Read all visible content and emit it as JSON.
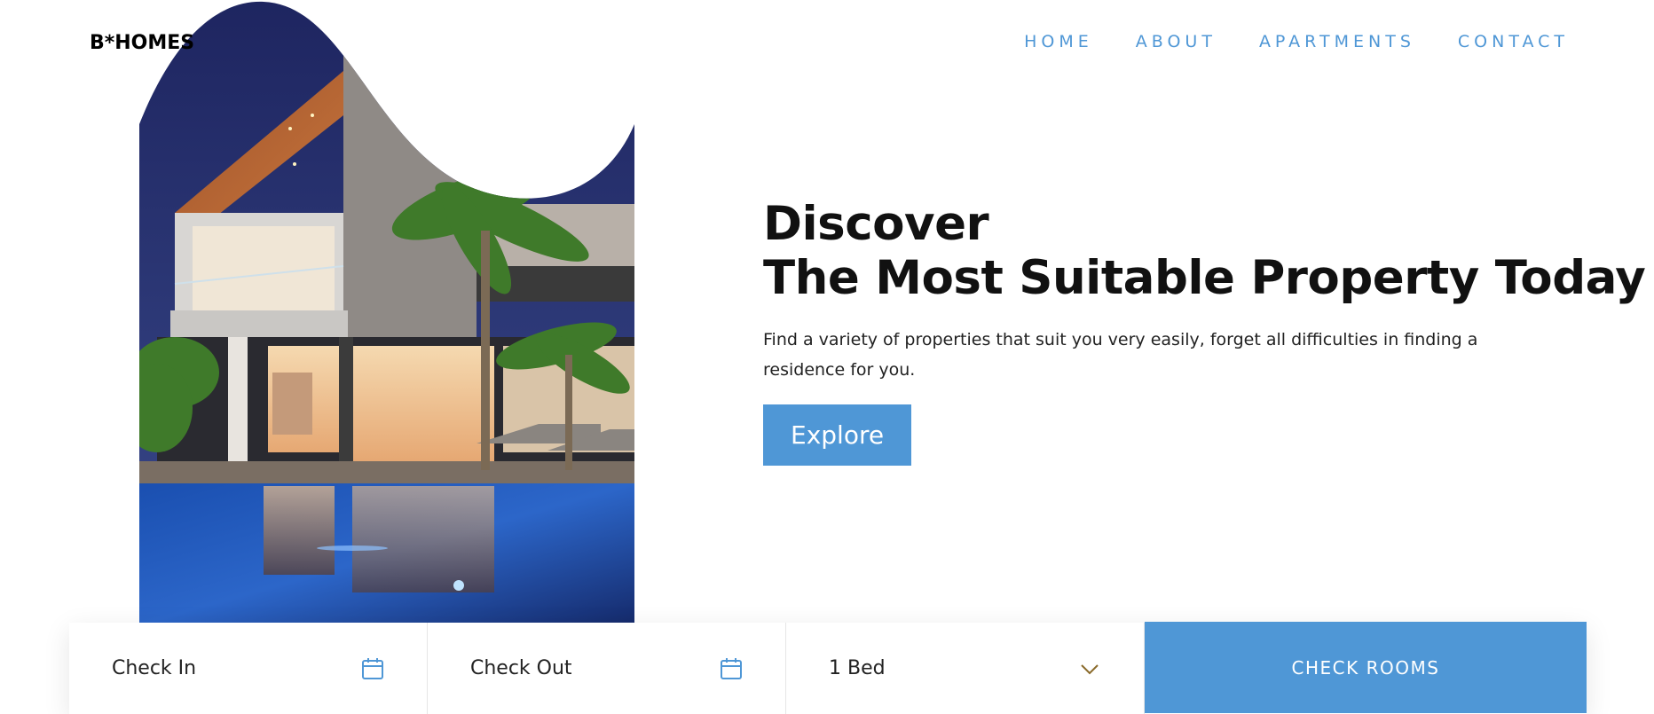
{
  "header": {
    "logo": "B*HOMES",
    "nav": [
      "HOME",
      "ABOUT",
      "APARTMENTS",
      "CONTACT"
    ]
  },
  "hero": {
    "title_line1": "Discover",
    "title_line2": "The Most Suitable Property Today",
    "description": "Find a variety of properties that suit you very easily, forget all difficulties in finding a residence for you.",
    "button": "Explore"
  },
  "booking": {
    "check_in": "Check In",
    "check_out": "Check Out",
    "beds": "1 Bed",
    "button": "CHECK ROOMS"
  },
  "colors": {
    "accent": "#4f97d6",
    "text": "#111111"
  },
  "icons": {
    "check_in": "calendar-icon",
    "check_out": "calendar-icon",
    "beds": "chevron-down-icon"
  }
}
